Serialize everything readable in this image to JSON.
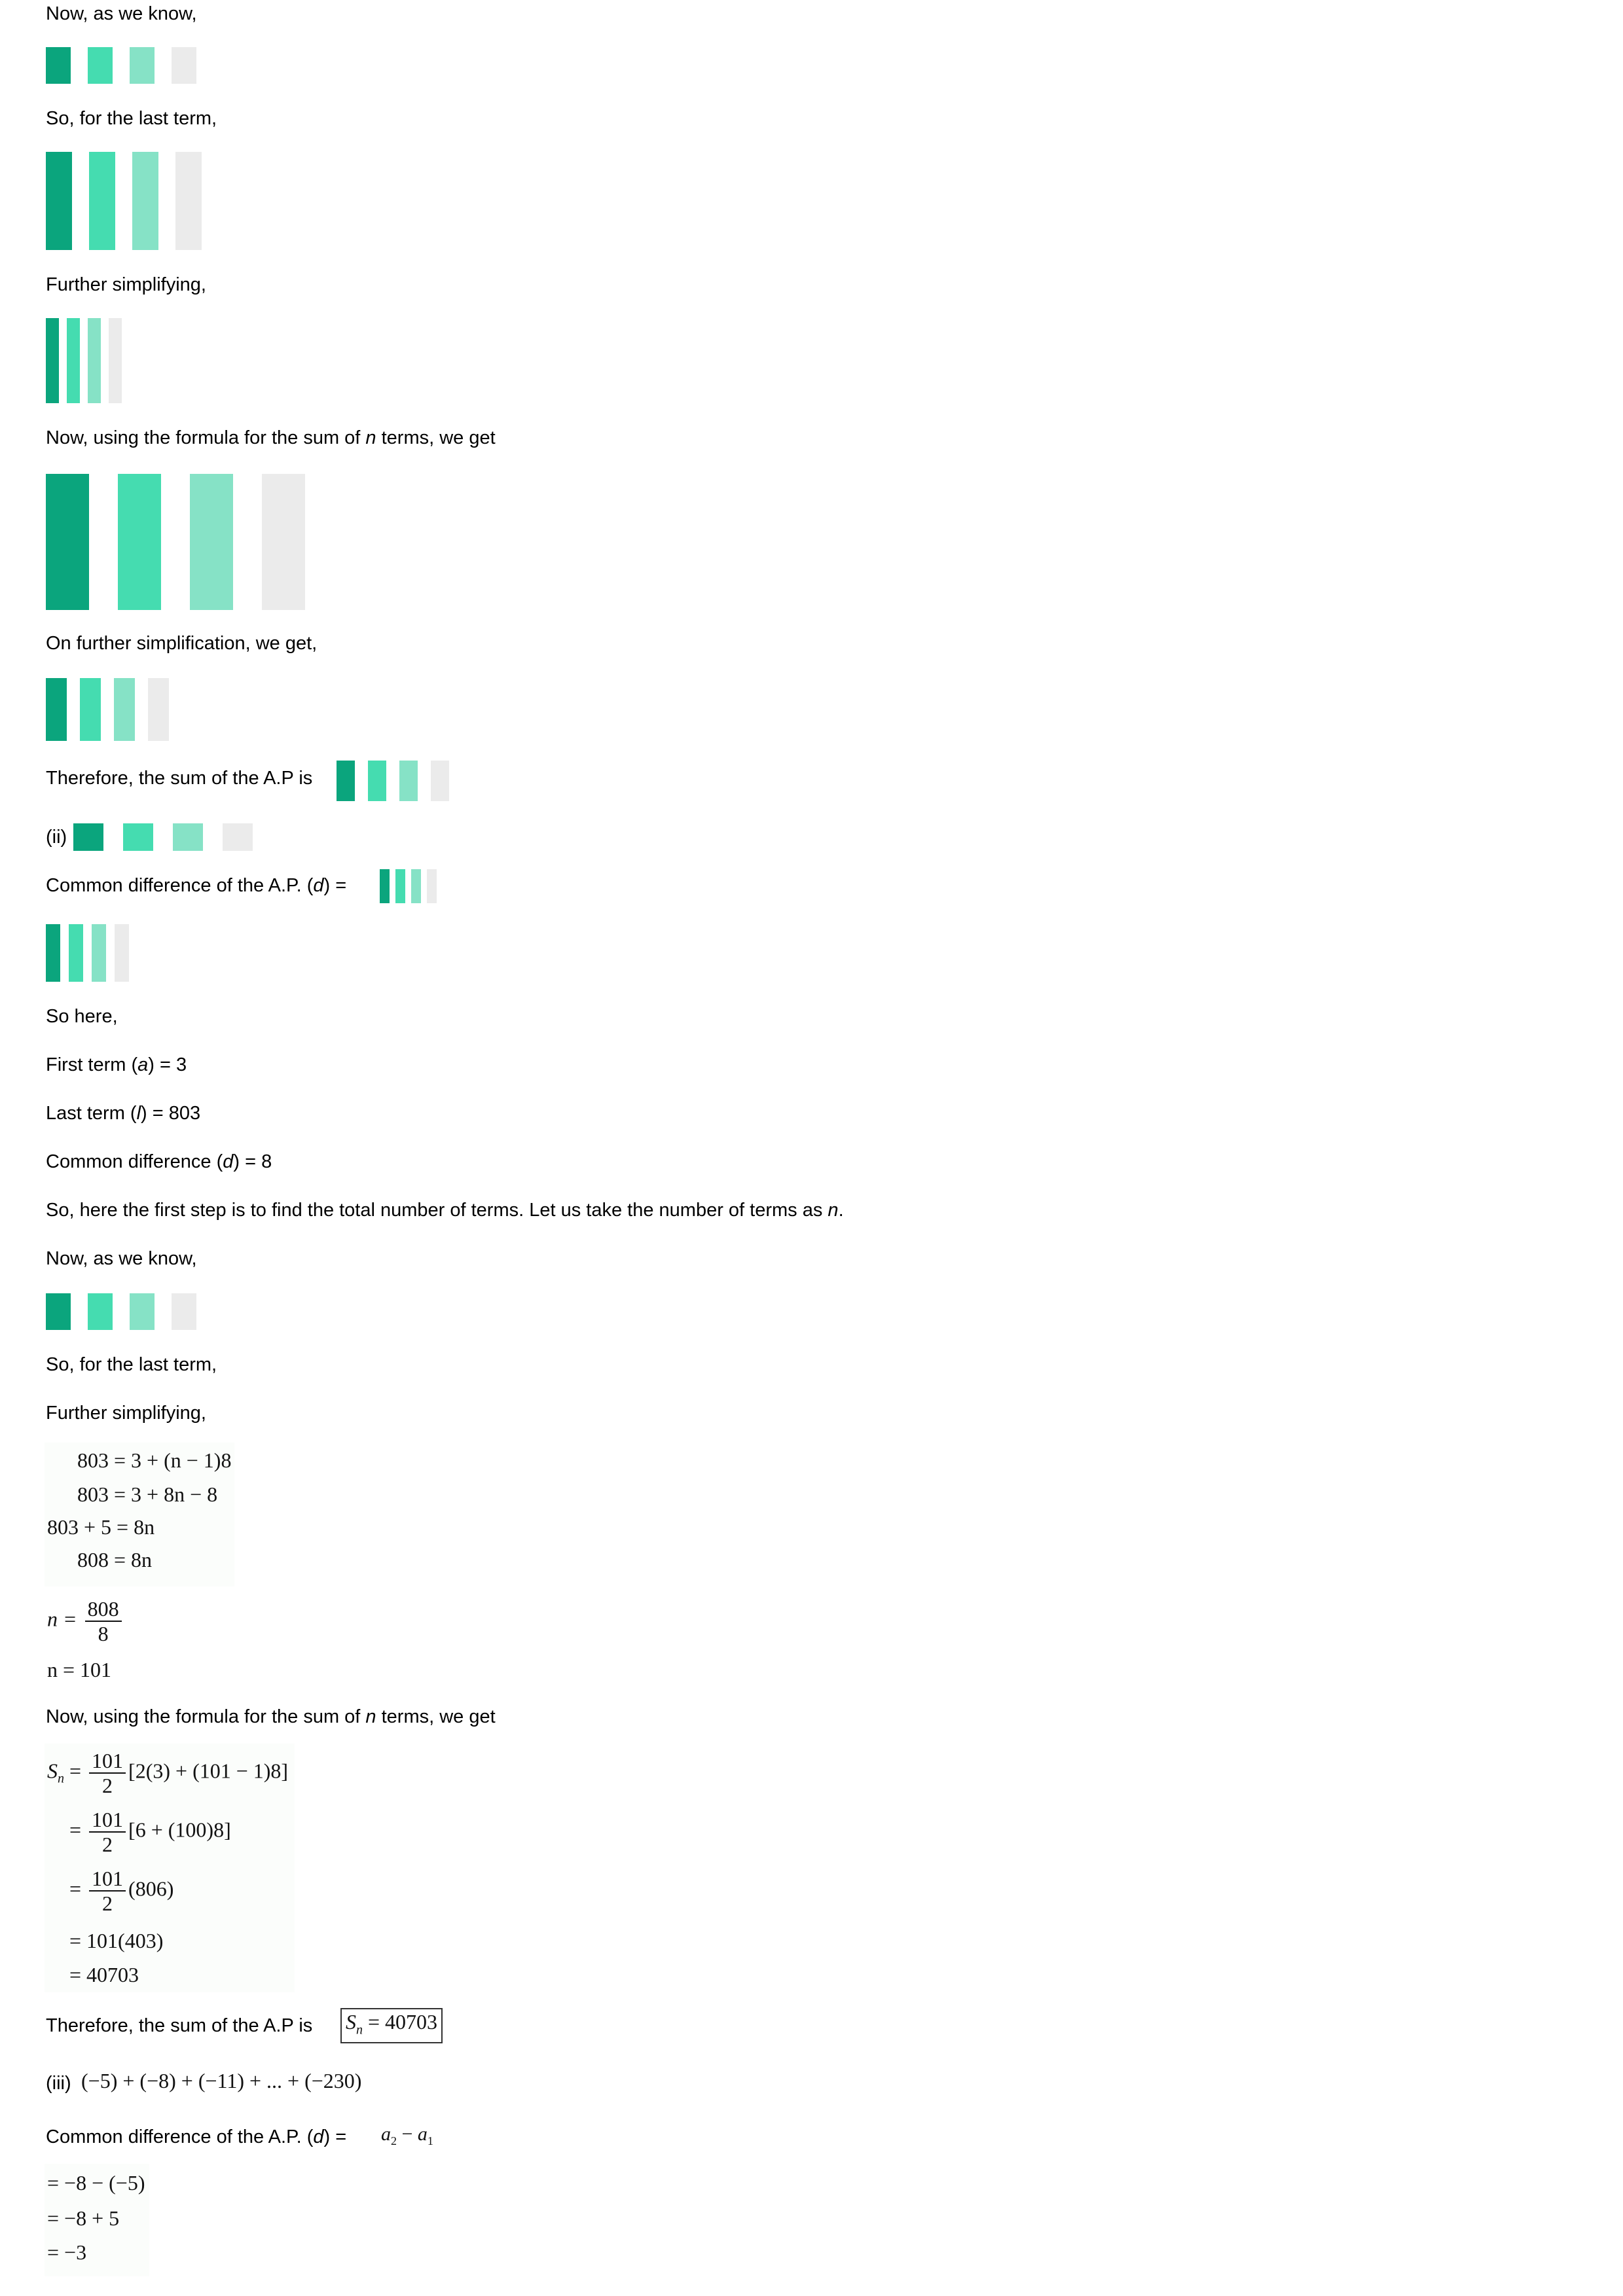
{
  "lines": {
    "now_know_1": "Now, as we know,",
    "last_term_1": "So, for the last term,",
    "further_1": "Further simplifying,",
    "sum_formula_1_pre": "Now, using the formula for the sum of ",
    "sum_formula_1_n": "n",
    "sum_formula_1_post": " terms, we get",
    "further_simplification": "On further simplification, we get,",
    "therefore_1": "Therefore, the sum of the A.P is",
    "part_ii": "(ii)",
    "common_diff_1": "Common difference of the A.P. (",
    "common_diff_1_d": "d",
    "common_diff_1_end": ") =",
    "so_here": "So here,",
    "first_term_pre": "First term (",
    "first_term_var": "a",
    "first_term_post": ") = 3",
    "last_term_pre": "Last term (",
    "last_term_var": "l",
    "last_term_post": ") = 803",
    "common_diff_pre": "Common difference (",
    "common_diff_var": "d",
    "common_diff_post": ") = 8",
    "first_step": "So, here the first step is to find the total number of terms. Let us take the number of terms as ",
    "first_step_n": "n",
    "first_step_end": ".",
    "now_know_2": "Now, as we know,",
    "last_term_2": "So, for the last term,",
    "further_2": "Further simplifying,",
    "sum_formula_2_pre": "Now, using the formula for the sum of ",
    "sum_formula_2_n": "n",
    "sum_formula_2_post": " terms, we get",
    "therefore_2": "Therefore, the sum of the A.P is",
    "part_iii": "(iii)",
    "common_diff_3": "Common difference of the A.P. (",
    "common_diff_3_d": "d",
    "common_diff_3_end": ") ="
  },
  "math": {
    "eq1": "803 = 3 + (n − 1)8",
    "eq2": "803 = 3 + 8n − 8",
    "eq3": "803 + 5 = 8n",
    "eq4": "808 = 8n",
    "n_lhs": "n =",
    "n_num": "808",
    "n_den": "8",
    "n_result": "n = 101",
    "s_lhs": "S",
    "s_sub": "n",
    "s_eq": "=",
    "frac_num": "101",
    "frac_den": "2",
    "s_line1": "[2(3) + (101 − 1)8]",
    "s_line2": "[6 + (100)8]",
    "s_line3": "(806)",
    "s_line4": "= 101(403)",
    "s_line5": "= 40703",
    "answer_S": "S",
    "answer_sub": "n",
    "answer_val": " = 40703",
    "series_iii": "(−5) + (−8) + (−11) + ... + (−230)",
    "diff_formula_a": "a",
    "diff_formula_sub2": "2",
    "diff_formula_minus": " − ",
    "diff_formula_sub1": "1",
    "diff_1": "= −8 − (−5)",
    "diff_2": "= −8 + 5",
    "diff_3": "= −3"
  },
  "colors": {
    "bar_dark": "#0ba57d",
    "bar_mid": "#45dcb0",
    "bar_light": "#86e2c6",
    "bar_gray": "#ebebeb"
  }
}
